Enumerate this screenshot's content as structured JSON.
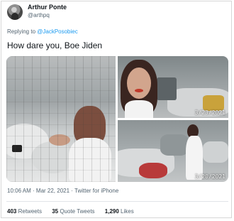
{
  "author": {
    "display_name": "Arthur Ponte",
    "handle": "@arthpq",
    "avatar_icon": "profile-photo-icon"
  },
  "reply": {
    "prefix": "Replying to ",
    "mention": "@JackPosobiec"
  },
  "tweet": {
    "text": "How dare you, Boe Jiden"
  },
  "media": {
    "photos": [
      {
        "date": ""
      },
      {
        "date": "3/23/2021"
      },
      {
        "date": "3/20/2021"
      }
    ]
  },
  "meta": {
    "timestamp": "10:06 AM · Mar 22, 2021 · Twitter for iPhone"
  },
  "stats": {
    "retweets_count": "403",
    "retweets_label": "Retweets",
    "quote_count": "35",
    "quote_label": "Quote Tweets",
    "likes_count": "1,290",
    "likes_label": "Likes"
  },
  "colors": {
    "link": "#1d9bf0",
    "secondary_text": "#536471",
    "primary_text": "#0f1419"
  }
}
